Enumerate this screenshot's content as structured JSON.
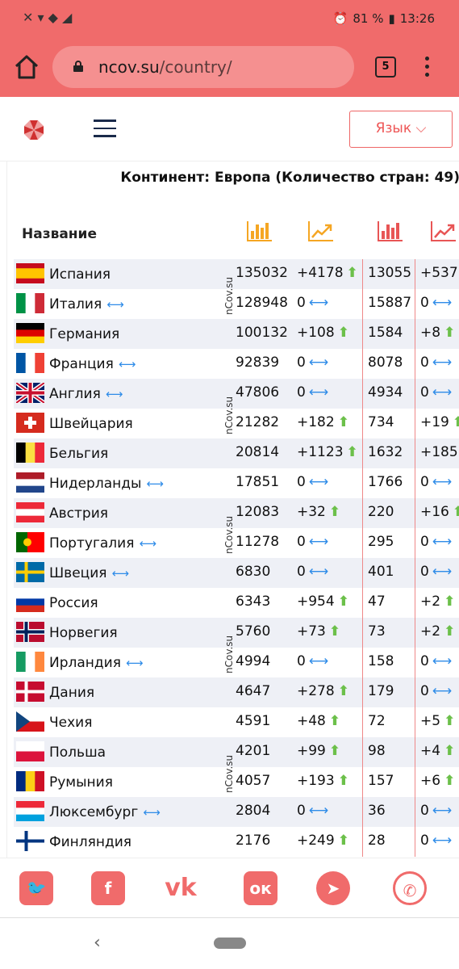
{
  "status": {
    "battery": "81 %",
    "time": "13:26"
  },
  "browser": {
    "url_host": "ncov.su",
    "url_path": "/country/",
    "tab_count": "5"
  },
  "header": {
    "lang_label": "Язык ⌵"
  },
  "table": {
    "continent_title": "Континент: Европа (Количество стран: 49)",
    "name_header": "Название",
    "watermark": "nCov.su",
    "rows": [
      {
        "name": "Испания",
        "same": false,
        "c1": "135032",
        "c2": "+4178",
        "c2_up": true,
        "c3": "13055",
        "c4": "+537",
        "c4_up": false,
        "flag": "es"
      },
      {
        "name": "Италия",
        "same": true,
        "c1": "128948",
        "c2": "0",
        "c2_up": false,
        "c3": "15887",
        "c4": "0",
        "c4_up": false,
        "flag": "it"
      },
      {
        "name": "Германия",
        "same": false,
        "c1": "100132",
        "c2": "+108",
        "c2_up": true,
        "c3": "1584",
        "c4": "+8",
        "c4_up": true,
        "flag": "de"
      },
      {
        "name": "Франция",
        "same": true,
        "c1": "92839",
        "c2": "0",
        "c2_up": false,
        "c3": "8078",
        "c4": "0",
        "c4_up": false,
        "flag": "fr"
      },
      {
        "name": "Англия",
        "same": true,
        "c1": "47806",
        "c2": "0",
        "c2_up": false,
        "c3": "4934",
        "c4": "0",
        "c4_up": false,
        "flag": "gb"
      },
      {
        "name": "Швейцария",
        "same": false,
        "c1": "21282",
        "c2": "+182",
        "c2_up": true,
        "c3": "734",
        "c4": "+19",
        "c4_up": true,
        "flag": "ch"
      },
      {
        "name": "Бельгия",
        "same": false,
        "c1": "20814",
        "c2": "+1123",
        "c2_up": true,
        "c3": "1632",
        "c4": "+185",
        "c4_up": false,
        "flag": "be"
      },
      {
        "name": "Нидерланды",
        "same": true,
        "c1": "17851",
        "c2": "0",
        "c2_up": false,
        "c3": "1766",
        "c4": "0",
        "c4_up": false,
        "flag": "nl"
      },
      {
        "name": "Австрия",
        "same": false,
        "c1": "12083",
        "c2": "+32",
        "c2_up": true,
        "c3": "220",
        "c4": "+16",
        "c4_up": true,
        "flag": "at"
      },
      {
        "name": "Португалия",
        "same": true,
        "c1": "11278",
        "c2": "0",
        "c2_up": false,
        "c3": "295",
        "c4": "0",
        "c4_up": false,
        "flag": "pt"
      },
      {
        "name": "Швеция",
        "same": true,
        "c1": "6830",
        "c2": "0",
        "c2_up": false,
        "c3": "401",
        "c4": "0",
        "c4_up": false,
        "flag": "se"
      },
      {
        "name": "Россия",
        "same": false,
        "c1": "6343",
        "c2": "+954",
        "c2_up": true,
        "c3": "47",
        "c4": "+2",
        "c4_up": true,
        "flag": "ru"
      },
      {
        "name": "Норвегия",
        "same": false,
        "c1": "5760",
        "c2": "+73",
        "c2_up": true,
        "c3": "73",
        "c4": "+2",
        "c4_up": true,
        "flag": "no"
      },
      {
        "name": "Ирландия",
        "same": true,
        "c1": "4994",
        "c2": "0",
        "c2_up": false,
        "c3": "158",
        "c4": "0",
        "c4_up": false,
        "flag": "ie"
      },
      {
        "name": "Дания",
        "same": false,
        "c1": "4647",
        "c2": "+278",
        "c2_up": true,
        "c3": "179",
        "c4": "0",
        "c4_up": false,
        "flag": "dk"
      },
      {
        "name": "Чехия",
        "same": false,
        "c1": "4591",
        "c2": "+48",
        "c2_up": true,
        "c3": "72",
        "c4": "+5",
        "c4_up": true,
        "flag": "cz"
      },
      {
        "name": "Польша",
        "same": false,
        "c1": "4201",
        "c2": "+99",
        "c2_up": true,
        "c3": "98",
        "c4": "+4",
        "c4_up": true,
        "flag": "pl"
      },
      {
        "name": "Румыния",
        "same": false,
        "c1": "4057",
        "c2": "+193",
        "c2_up": true,
        "c3": "157",
        "c4": "+6",
        "c4_up": true,
        "flag": "ro"
      },
      {
        "name": "Люксембург",
        "same": true,
        "c1": "2804",
        "c2": "0",
        "c2_up": false,
        "c3": "36",
        "c4": "0",
        "c4_up": false,
        "flag": "lu"
      },
      {
        "name": "Финляндия",
        "same": false,
        "c1": "2176",
        "c2": "+249",
        "c2_up": true,
        "c3": "28",
        "c4": "0",
        "c4_up": false,
        "flag": "fi"
      }
    ]
  },
  "colors": {
    "accent": "#f06b6b",
    "up": "#6cc04a",
    "same": "#2f8ce8",
    "header_icon_orange": "#f5a623",
    "header_icon_red": "#e85555"
  },
  "share": [
    "twitter-icon",
    "facebook-icon",
    "vk-icon",
    "odnoklassniki-icon",
    "telegram-icon",
    "whatsapp-icon"
  ]
}
